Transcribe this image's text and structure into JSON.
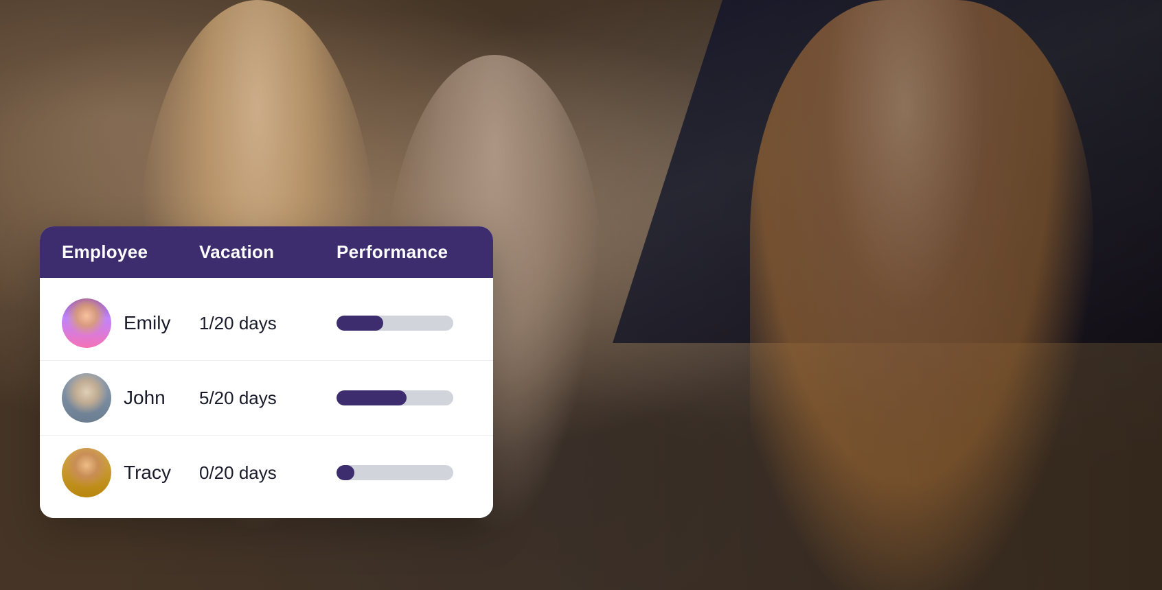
{
  "header": {
    "employee_label": "Employee",
    "vacation_label": "Vacation",
    "performance_label": "Performance"
  },
  "employees": [
    {
      "name": "Emily",
      "vacation": "1/20 days",
      "performance_pct": 40,
      "avatar_type": "emily"
    },
    {
      "name": "John",
      "vacation": "5/20 days",
      "performance_pct": 60,
      "avatar_type": "john"
    },
    {
      "name": "Tracy",
      "vacation": "0/20 days",
      "performance_pct": 15,
      "avatar_type": "tracy"
    }
  ],
  "colors": {
    "header_bg": "#3d2c6e",
    "progress_fill": "#3d2c6e",
    "progress_bg": "#d1d5db"
  }
}
